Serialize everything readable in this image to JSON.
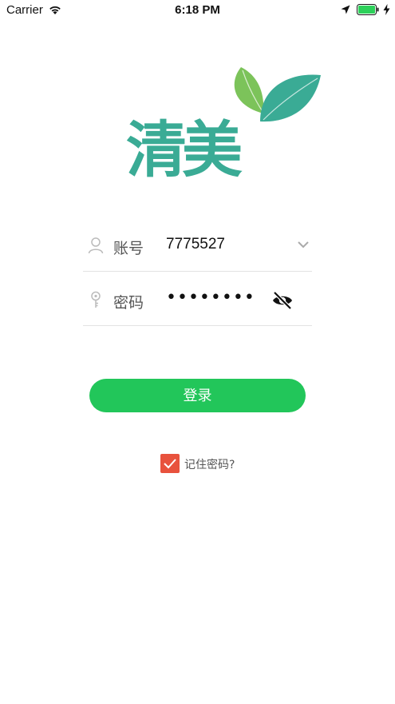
{
  "status_bar": {
    "carrier": "Carrier",
    "time": "6:18 PM",
    "icons": [
      "wifi-icon",
      "location-arrow-icon",
      "battery-icon",
      "charging-bolt-icon"
    ]
  },
  "logo": {
    "text": "清美",
    "colors": {
      "text": "#3aab95",
      "leaf_light": "#7cc35a",
      "leaf_dark": "#3aab95"
    }
  },
  "form": {
    "account": {
      "label": "账号",
      "value": "7775527",
      "icon": "user-icon",
      "dropdown_icon": "chevron-down-icon"
    },
    "password": {
      "label": "密码",
      "masked_value": "••••••••",
      "icon": "key-icon",
      "toggle_icon": "eye-slash-icon"
    }
  },
  "login_button": {
    "label": "登录",
    "color": "#22c65a"
  },
  "remember": {
    "label": "记住密码?",
    "checked": true,
    "color": "#e8523d"
  }
}
